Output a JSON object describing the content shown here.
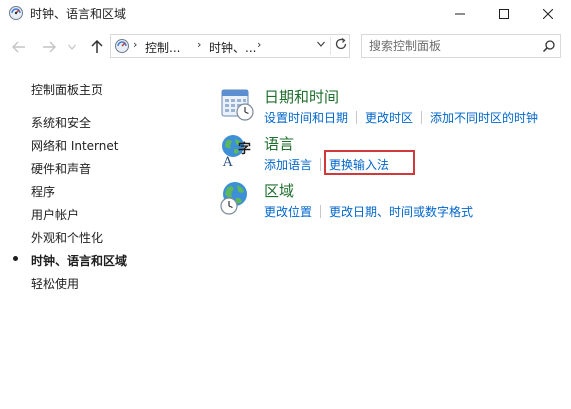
{
  "window": {
    "title": "时钟、语言和区域",
    "icon": "control-panel-icon"
  },
  "navigation": {
    "back_icon": "back-arrow-icon",
    "forward_icon": "forward-arrow-icon",
    "up_icon": "up-arrow-icon"
  },
  "address": {
    "crumbs": [
      "控制...",
      "时钟、...",
      ""
    ],
    "separator": "›"
  },
  "search": {
    "placeholder": "搜索控制面板"
  },
  "sidebar": {
    "home": "控制面板主页",
    "items": [
      {
        "label": "系统和安全"
      },
      {
        "label": "网络和 Internet"
      },
      {
        "label": "硬件和声音"
      },
      {
        "label": "程序"
      },
      {
        "label": "用户帐户"
      },
      {
        "label": "外观和个性化"
      },
      {
        "label": "时钟、语言和区域",
        "current": true
      },
      {
        "label": "轻松使用"
      }
    ]
  },
  "categories": [
    {
      "title": "日期和时间",
      "icon": "calendar-clock-icon",
      "links": [
        "设置时间和日期",
        "更改时区",
        "添加不同时区的时钟"
      ]
    },
    {
      "title": "语言",
      "icon": "language-globe-icon",
      "links": [
        "添加语言",
        "更换输入法"
      ]
    },
    {
      "title": "区域",
      "icon": "region-globe-icon",
      "links": [
        "更改位置",
        "更改日期、时间或数字格式"
      ]
    }
  ],
  "colors": {
    "link": "#0066cc",
    "category_title": "#1e6e2c",
    "highlight": "#d03a3a"
  }
}
